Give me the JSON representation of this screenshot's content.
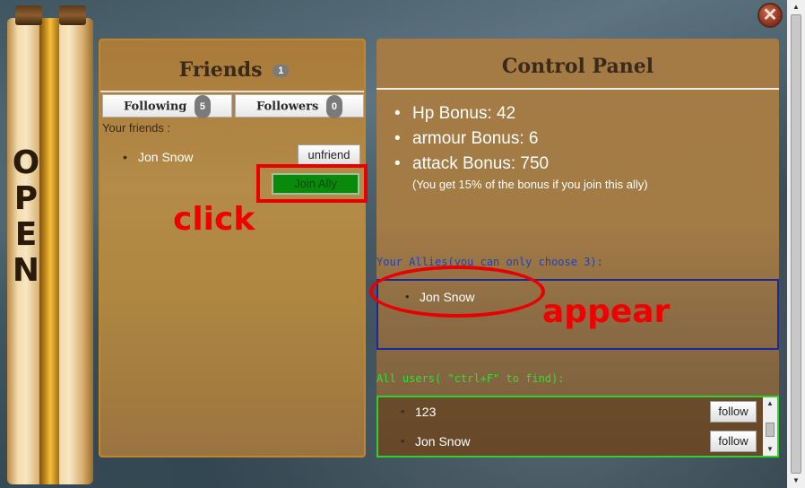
{
  "scroll": {
    "letters": [
      "O",
      "P",
      "E",
      "N"
    ]
  },
  "close": {
    "glyph": "✕"
  },
  "friends": {
    "title": "Friends",
    "count": "1",
    "tabs": [
      {
        "label": "Following",
        "count": "5"
      },
      {
        "label": "Followers",
        "count": "0"
      }
    ],
    "your_friends_label": "Your friends :",
    "items": [
      {
        "name": "Jon Snow",
        "unfriend_label": "unfriend",
        "join_label": "Join Ally"
      }
    ]
  },
  "annotations": {
    "click": "click",
    "appear": "appear"
  },
  "control_panel": {
    "title": "Control Panel",
    "bonuses": [
      "Hp Bonus: 42",
      "armour Bonus: 6",
      "attack Bonus: 750"
    ],
    "note": "(You get 15% of the bonus if you join this ally)",
    "allies_label": "Your Allies(you can only choose 3):",
    "allies": [
      "Jon Snow"
    ],
    "users_label": "All users( \"ctrl+F\" to find):",
    "users": [
      {
        "name": "123",
        "follow_label": "follow"
      },
      {
        "name": "Jon Snow",
        "follow_label": "follow"
      }
    ]
  },
  "colors": {
    "annotation_red": "#f00000",
    "join_green": "#0a8a0a",
    "allies_blue": "#2040c0",
    "users_green": "#30e030"
  }
}
